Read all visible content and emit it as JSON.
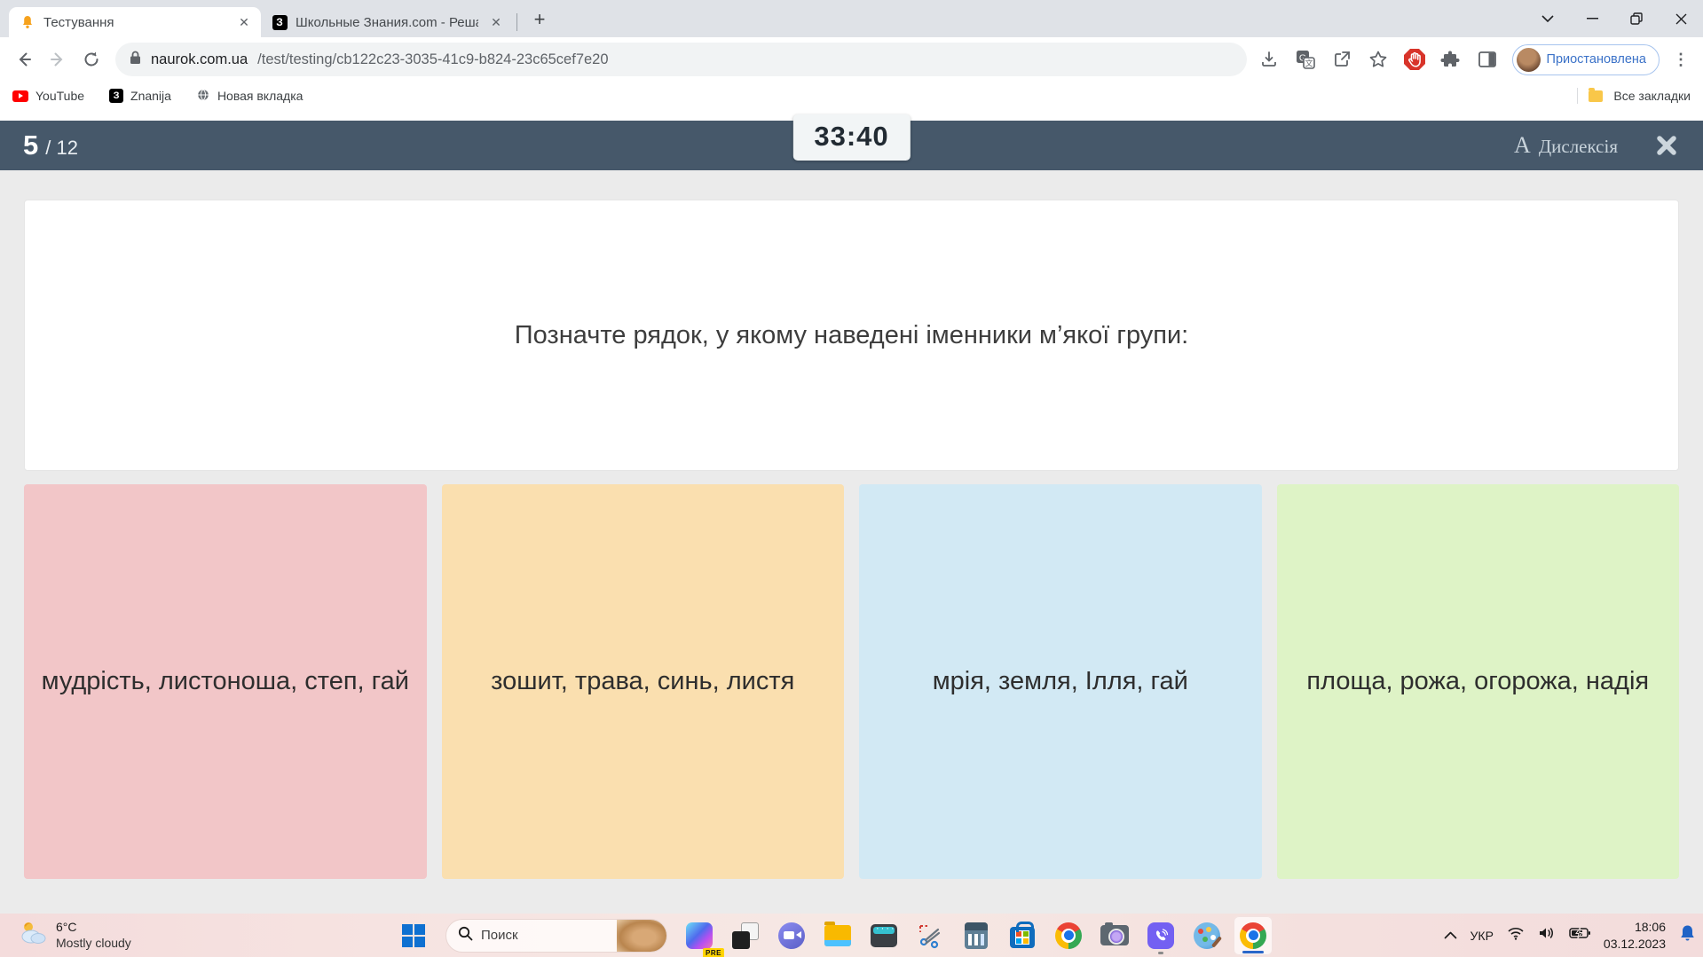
{
  "browser": {
    "tabs": [
      {
        "title": "Тестування",
        "icon": "bell-icon"
      },
      {
        "title": "Школьные Знания.com - Реша",
        "icon": "znanija-icon",
        "icon_letter": "З"
      }
    ],
    "url_domain": "naurok.com.ua",
    "url_path": "/test/testing/cb122c23-3035-41c9-b824-23c65cef7e20",
    "profile_label": "Приостановлена",
    "bookmarks": [
      "YouTube",
      "Znanija",
      "Новая вкладка"
    ],
    "all_bookmarks_label": "Все закладки",
    "new_tab_glyph": "+",
    "tab_close_glyph": "✕",
    "kebab_glyph": "⋮"
  },
  "quiz": {
    "progress_current": "5",
    "progress_rest": "/ 12",
    "timer": "33:40",
    "dyslexia_icon": "А",
    "dyslexia_label": "Дислексія",
    "question": "Позначте рядок, у якому наведені іменники м’якої групи:",
    "answers": [
      {
        "text": "мудрість, листоноша, степ, гай",
        "color": "#f2c6c8"
      },
      {
        "text": "зошит, трава, синь, листя",
        "color": "#fadfaf"
      },
      {
        "text": "мрія, земля, Ілля, гай",
        "color": "#d2e9f4"
      },
      {
        "text": "площа, рожа, огорожа, надія",
        "color": "#def3c6"
      }
    ],
    "colors": {
      "header_bg": "#46586a",
      "timer_bg": "#f2f5f6"
    }
  },
  "taskbar": {
    "weather_temp": "6°C",
    "weather_desc": "Mostly cloudy",
    "search_placeholder": "Поиск",
    "copilot_badge": "PRE",
    "language": "УКР",
    "time": "18:06",
    "date": "03.12.2023",
    "bell_color": "#1f63c6"
  },
  "icons_used": [
    "bell-icon",
    "znanija-icon",
    "globe-icon",
    "youtube-icon",
    "folder-icon",
    "back-icon",
    "forward-icon",
    "reload-icon",
    "lock-icon",
    "download-icon",
    "translate-icon",
    "share-icon",
    "star-icon",
    "adblock-icon",
    "puzzle-icon",
    "sidebar-icon",
    "chevron-down-icon",
    "minimize-icon",
    "restore-icon",
    "close-icon",
    "search-icon",
    "windows-start-icon",
    "copilot-icon",
    "task-view-icon",
    "chat-icon",
    "file-explorer-icon",
    "keyboard-icon",
    "snipping-tool-icon",
    "calculator-icon",
    "store-icon",
    "chrome-icon",
    "camera-icon",
    "viber-icon",
    "paint-icon",
    "chevron-up-icon",
    "wifi-icon",
    "volume-icon",
    "battery-icon",
    "notification-bell-icon",
    "weather-icon"
  ]
}
